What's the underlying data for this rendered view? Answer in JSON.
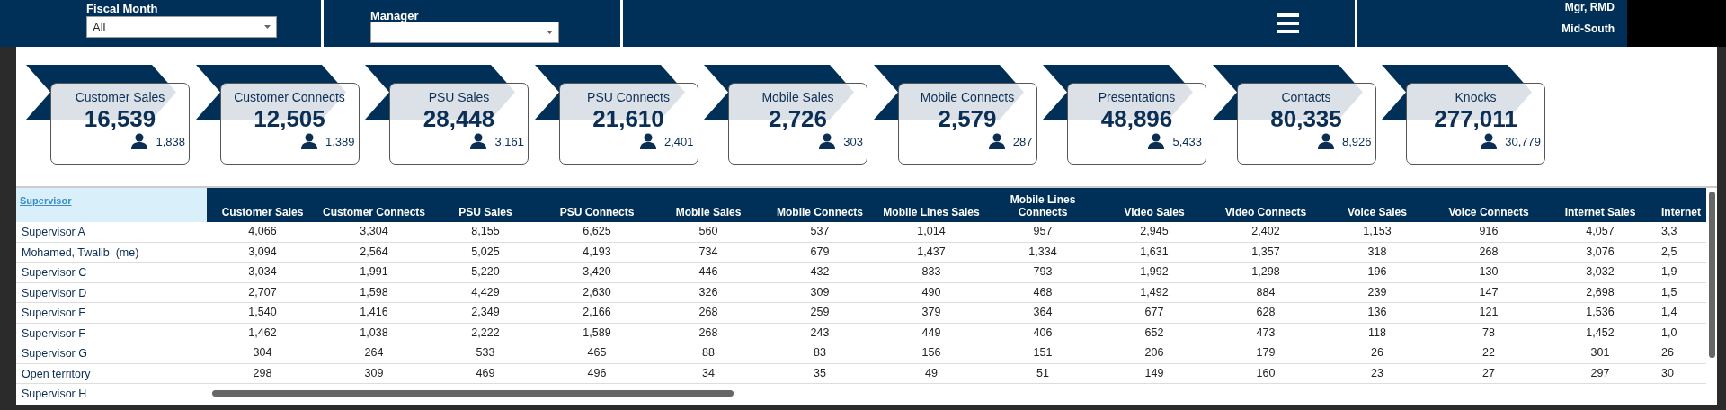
{
  "filters": [
    {
      "label": "Fiscal Month",
      "value": "All"
    },
    {
      "label": "Manager"
    }
  ],
  "header_info": [
    "Mgr, RMD",
    "Mid-South"
  ],
  "kpi_cards": [
    {
      "title": "Customer Sales",
      "value": "16,539",
      "count": "1,838"
    },
    {
      "title": "Customer Connects",
      "value": "12,505",
      "count": "1,389"
    },
    {
      "title": "PSU Sales",
      "value": "28,448",
      "count": "3,161"
    },
    {
      "title": "PSU Connects",
      "value": "21,610",
      "count": "2,401"
    },
    {
      "title": "Mobile Sales",
      "value": "2,726",
      "count": "303"
    },
    {
      "title": "Mobile Connects",
      "value": "2,579",
      "count": "287"
    },
    {
      "title": "Presentations",
      "value": "48,896",
      "count": "5,433"
    },
    {
      "title": "Contacts",
      "value": "80,335",
      "count": "8,926"
    },
    {
      "title": "Knocks",
      "value": "277,011",
      "count": "30,779"
    }
  ],
  "table": {
    "columns": [
      "Supervisor",
      "Customer Sales",
      "Customer Connects",
      "PSU Sales",
      "PSU Connects",
      "Mobile Sales",
      "Mobile Connects",
      "Mobile Lines Sales",
      "Mobile Lines Connects",
      "Video Sales",
      "Video Connects",
      "Voice Sales",
      "Voice Connects",
      "Internet Sales",
      "Internet"
    ],
    "rows": [
      [
        "Supervisor A",
        "4,066",
        "3,304",
        "8,155",
        "6,625",
        "560",
        "537",
        "1,014",
        "957",
        "2,945",
        "2,402",
        "1,153",
        "916",
        "4,057",
        "3,3"
      ],
      [
        "Mohamed, Twalib  (me)",
        "3,094",
        "2,564",
        "5,025",
        "4,193",
        "734",
        "679",
        "1,437",
        "1,334",
        "1,631",
        "1,357",
        "318",
        "268",
        "3,076",
        "2,5"
      ],
      [
        "Supervisor C",
        "3,034",
        "1,991",
        "5,220",
        "3,420",
        "446",
        "432",
        "833",
        "793",
        "1,992",
        "1,298",
        "196",
        "130",
        "3,032",
        "1,9"
      ],
      [
        "Supervisor D",
        "2,707",
        "1,598",
        "4,429",
        "2,630",
        "326",
        "309",
        "490",
        "468",
        "1,492",
        "884",
        "239",
        "147",
        "2,698",
        "1,5"
      ],
      [
        "Supervisor E",
        "1,540",
        "1,416",
        "2,349",
        "2,166",
        "268",
        "259",
        "379",
        "364",
        "677",
        "628",
        "136",
        "121",
        "1,536",
        "1,4"
      ],
      [
        "Supervisor F",
        "1,462",
        "1,038",
        "2,222",
        "1,589",
        "268",
        "243",
        "449",
        "406",
        "652",
        "473",
        "118",
        "78",
        "1,452",
        "1,0"
      ],
      [
        "Supervisor G",
        "304",
        "264",
        "533",
        "465",
        "88",
        "83",
        "156",
        "151",
        "206",
        "179",
        "26",
        "22",
        "301",
        "26"
      ],
      [
        "Open territory",
        "298",
        "309",
        "469",
        "496",
        "34",
        "35",
        "49",
        "51",
        "149",
        "160",
        "23",
        "27",
        "297",
        "30"
      ],
      [
        "Supervisor H"
      ]
    ]
  }
}
